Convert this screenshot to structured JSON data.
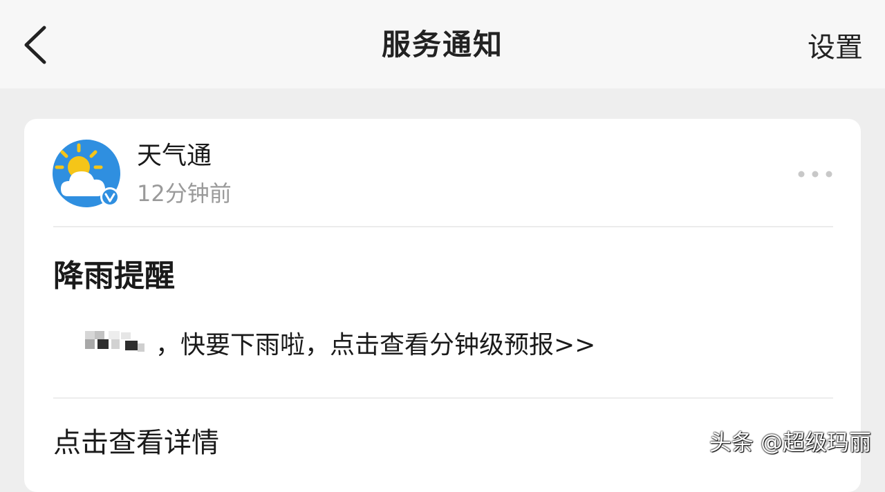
{
  "navbar": {
    "back_icon": "chevron-left-icon",
    "title": "服务通知",
    "settings_label": "设置"
  },
  "message": {
    "sender": {
      "name": "天气通",
      "time": "12分钟前",
      "avatar_icon": "sun-cloud-icon",
      "verified_badge": "v"
    },
    "more_icon": "more-dots-icon",
    "title": "降雨提醒",
    "body_redacted_icon": "mosaic-blur",
    "body": "，快要下雨啦，点击查看分钟级预报>>",
    "detail_label": "点击查看详情",
    "detail_icon": "chevron-right-icon"
  },
  "watermark": "头条 @超级玛丽",
  "colors": {
    "navbar_bg": "#f7f7f7",
    "page_bg": "#eeeeee",
    "card_bg": "#ffffff",
    "primary_text": "#1a1a1a",
    "secondary_text": "#9a9a9a",
    "avatar_blue": "#2f8fe0",
    "sun_yellow": "#f5c518"
  }
}
